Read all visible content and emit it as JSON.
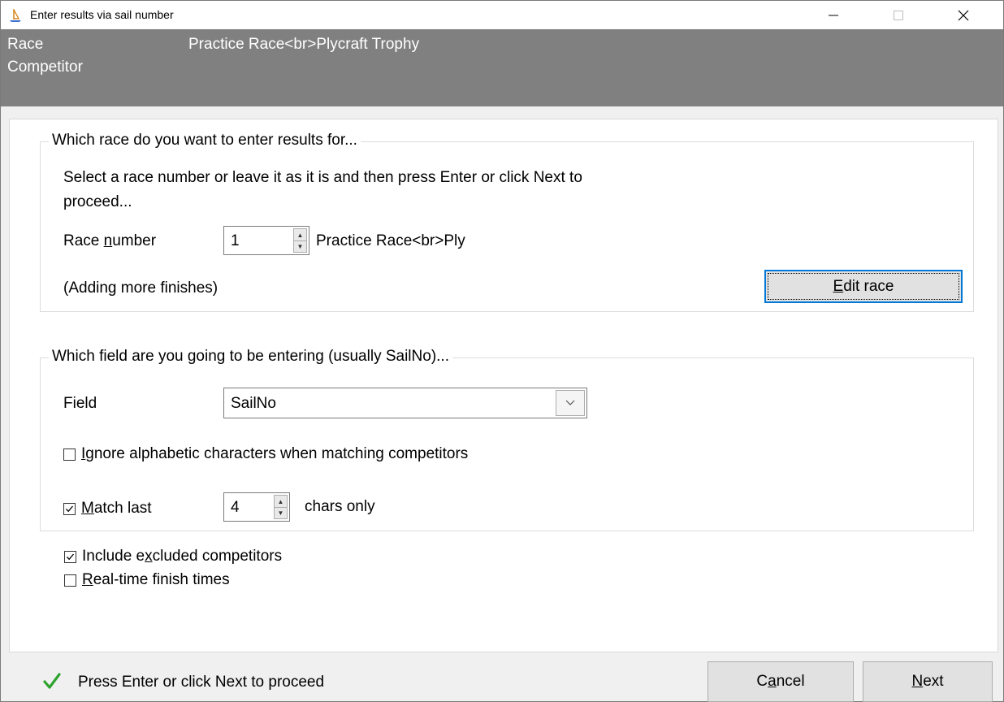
{
  "window": {
    "title": "Enter results via sail number",
    "minimize": "–",
    "maximize": "□",
    "close": "✕"
  },
  "header": {
    "label_race": "Race",
    "label_competitor": "Competitor",
    "race_value": "Practice Race<br>Plycraft Trophy"
  },
  "race_group": {
    "legend": "Which race do you want to enter results for...",
    "instruction_line1": "Select a race number or leave it as it is and then press Enter or click Next to",
    "instruction_line2": "proceed...",
    "race_number_label_pre": "Race ",
    "race_number_label_u": "n",
    "race_number_label_post": "umber",
    "race_number_value": "1",
    "race_name": "Practice Race<br>Ply",
    "status_text": "(Adding more finishes)",
    "edit_race_u": "E",
    "edit_race_rest": "dit race"
  },
  "field_group": {
    "legend": "Which field are you going to be entering (usually SailNo)...",
    "field_label": "Field",
    "field_value": "SailNo",
    "ignore_alpha_u": "I",
    "ignore_alpha_rest": "gnore alphabetic characters when matching competitors",
    "ignore_alpha_checked": false,
    "match_last_u": "M",
    "match_last_rest": "atch last",
    "match_last_checked": true,
    "match_last_value": "4",
    "chars_only": "chars only"
  },
  "options": {
    "include_excluded_pre": "Include e",
    "include_excluded_u": "x",
    "include_excluded_post": "cluded competitors",
    "include_excluded_checked": true,
    "realtime_u": "R",
    "realtime_rest": "eal-time finish times",
    "realtime_checked": false
  },
  "footer": {
    "hint": "Press Enter or click Next to proceed",
    "cancel_pre": "C",
    "cancel_u": "a",
    "cancel_post": "ncel",
    "next_u": "N",
    "next_rest": "ext"
  },
  "colors": {
    "header_bg": "#808080",
    "focus_blue": "#0078d7",
    "check_green": "#2ea32e"
  }
}
